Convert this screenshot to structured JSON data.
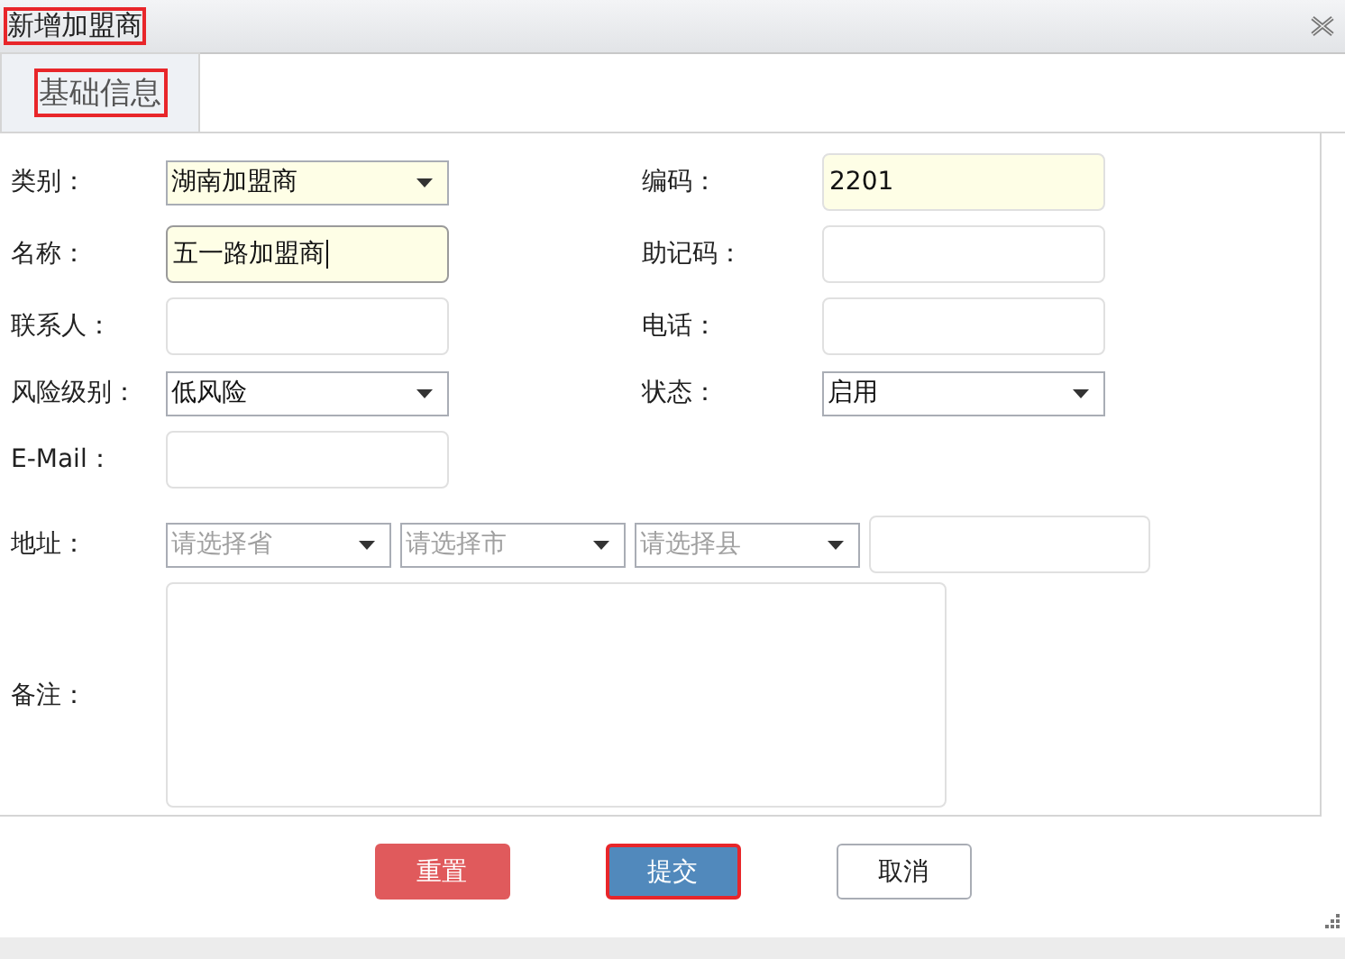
{
  "window": {
    "title": "新增加盟商",
    "marked": true
  },
  "tabs": [
    {
      "label": "基础信息",
      "selected": true,
      "marked": true
    }
  ],
  "rows": [
    {
      "left": {
        "label": "类别：",
        "kind": "select",
        "value": "湖南加盟商",
        "highlighted": true
      },
      "right": {
        "label": "编码：",
        "kind": "text",
        "value": "2201",
        "highlighted": true
      }
    },
    {
      "left": {
        "label": "名称：",
        "kind": "text",
        "value": "五一路加盟商",
        "highlighted": true,
        "focused": true
      },
      "right": {
        "label": "助记码：",
        "kind": "text"
      }
    },
    {
      "left": {
        "label": "联系人：",
        "kind": "text"
      },
      "right": {
        "label": "电话：",
        "kind": "text"
      }
    },
    {
      "left": {
        "label": "风险级别：",
        "kind": "select",
        "value": "低风险"
      },
      "right": {
        "label": "状态：",
        "kind": "select",
        "value": "启用"
      }
    },
    {
      "left": {
        "label": "E-Mail：",
        "kind": "text"
      }
    }
  ],
  "address": {
    "label": "地址：",
    "selects": [
      {
        "placeholder": "请选择省"
      },
      {
        "placeholder": "请选择市"
      },
      {
        "placeholder": "请选择县"
      }
    ]
  },
  "remarks": {
    "label": "备注："
  },
  "buttons": [
    {
      "label": "重置",
      "kind": "danger",
      "marked": false
    },
    {
      "label": "提交",
      "kind": "primary",
      "marked": true
    },
    {
      "label": "取消",
      "kind": "plain",
      "marked": false
    }
  ]
}
